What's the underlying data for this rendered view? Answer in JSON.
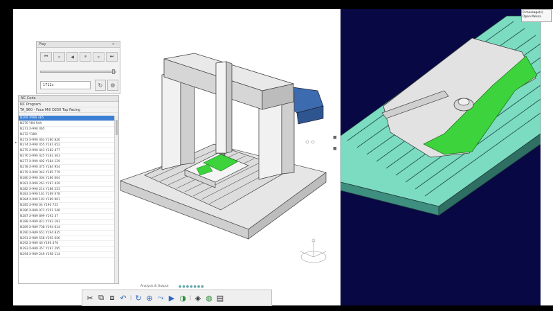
{
  "play_panel": {
    "title": "Play",
    "header_controls": "× –",
    "controls": [
      {
        "name": "first",
        "glyph": "⏮"
      },
      {
        "name": "rewind",
        "glyph": "«"
      },
      {
        "name": "step-back",
        "glyph": "◀"
      },
      {
        "name": "pause",
        "glyph": "⏸"
      },
      {
        "name": "forward",
        "glyph": "»"
      },
      {
        "name": "last",
        "glyph": "⏭"
      }
    ],
    "speed_value": "1712c",
    "slider_position": 0.97
  },
  "nc_panel": {
    "title": "NC Code",
    "program_label": "NC Program",
    "operation": "TA_960 - Face Mill D250 Top Facing",
    "selected_line": "N269 X990 465",
    "lines": [
      "N269 X990 465",
      "N270 Y84 944",
      "N271 X-990 465",
      "N272 Y180",
      "N273 X-990 463 Y180 826",
      "N274 X-990 455 Y181 652",
      "N275 X-990 443 Y182 477",
      "N276 X-990 425 Y183 303",
      "N277 X-990 402 Y184 129",
      "N278 X-990 375 Y184 954",
      "N279 X-990 342 Y185 779",
      "N280 X-990 304 Y186 604",
      "N281 X-990 261 Y187 429",
      "N282 X-990 214 Y188 253",
      "N283 X-990 161 Y189 078",
      "N284 X-990 103 Y189 901",
      "N285 X-990 04 Y190 725",
      "N286 X-989 972 Y191 548",
      "N287 X-989 899 Y192 37",
      "N288 X-989 821 Y193 193",
      "N289 X-989 738 Y194 014",
      "N290 X-989 651 Y194 835",
      "N291 X-989 558 Y195 656",
      "N292 X-989 46 Y196 476",
      "N293 X-989 357 Y197 295",
      "N294 X-989 249 Y198 114"
    ]
  },
  "analysis_output": {
    "label": "Analysis & Output",
    "dots": "●●●●●●●"
  },
  "toolbar": {
    "tools": [
      {
        "name": "cut",
        "glyph": "✂"
      },
      {
        "name": "copy",
        "glyph": "⧉"
      },
      {
        "name": "paste",
        "glyph": "⧈"
      },
      {
        "name": "undo",
        "glyph": "↶"
      },
      {
        "name": "reset-view",
        "glyph": "↻"
      },
      {
        "name": "add-operation",
        "glyph": "⊕"
      },
      {
        "name": "tool-path",
        "glyph": "⤳"
      },
      {
        "name": "simulate",
        "glyph": "▶"
      },
      {
        "name": "verify",
        "glyph": "◑"
      },
      {
        "name": "collision",
        "glyph": "◈"
      },
      {
        "name": "measure",
        "glyph": "◍"
      },
      {
        "name": "report",
        "glyph": "▤"
      }
    ]
  },
  "notification": {
    "line1": "0 message(s)",
    "line2": "Open Messa"
  },
  "colors": {
    "selection": "#3a7fd3",
    "stock_green": "#3cd33c",
    "table_cyan": "#7cdcc1",
    "viewport_right_bg": "#080844"
  }
}
